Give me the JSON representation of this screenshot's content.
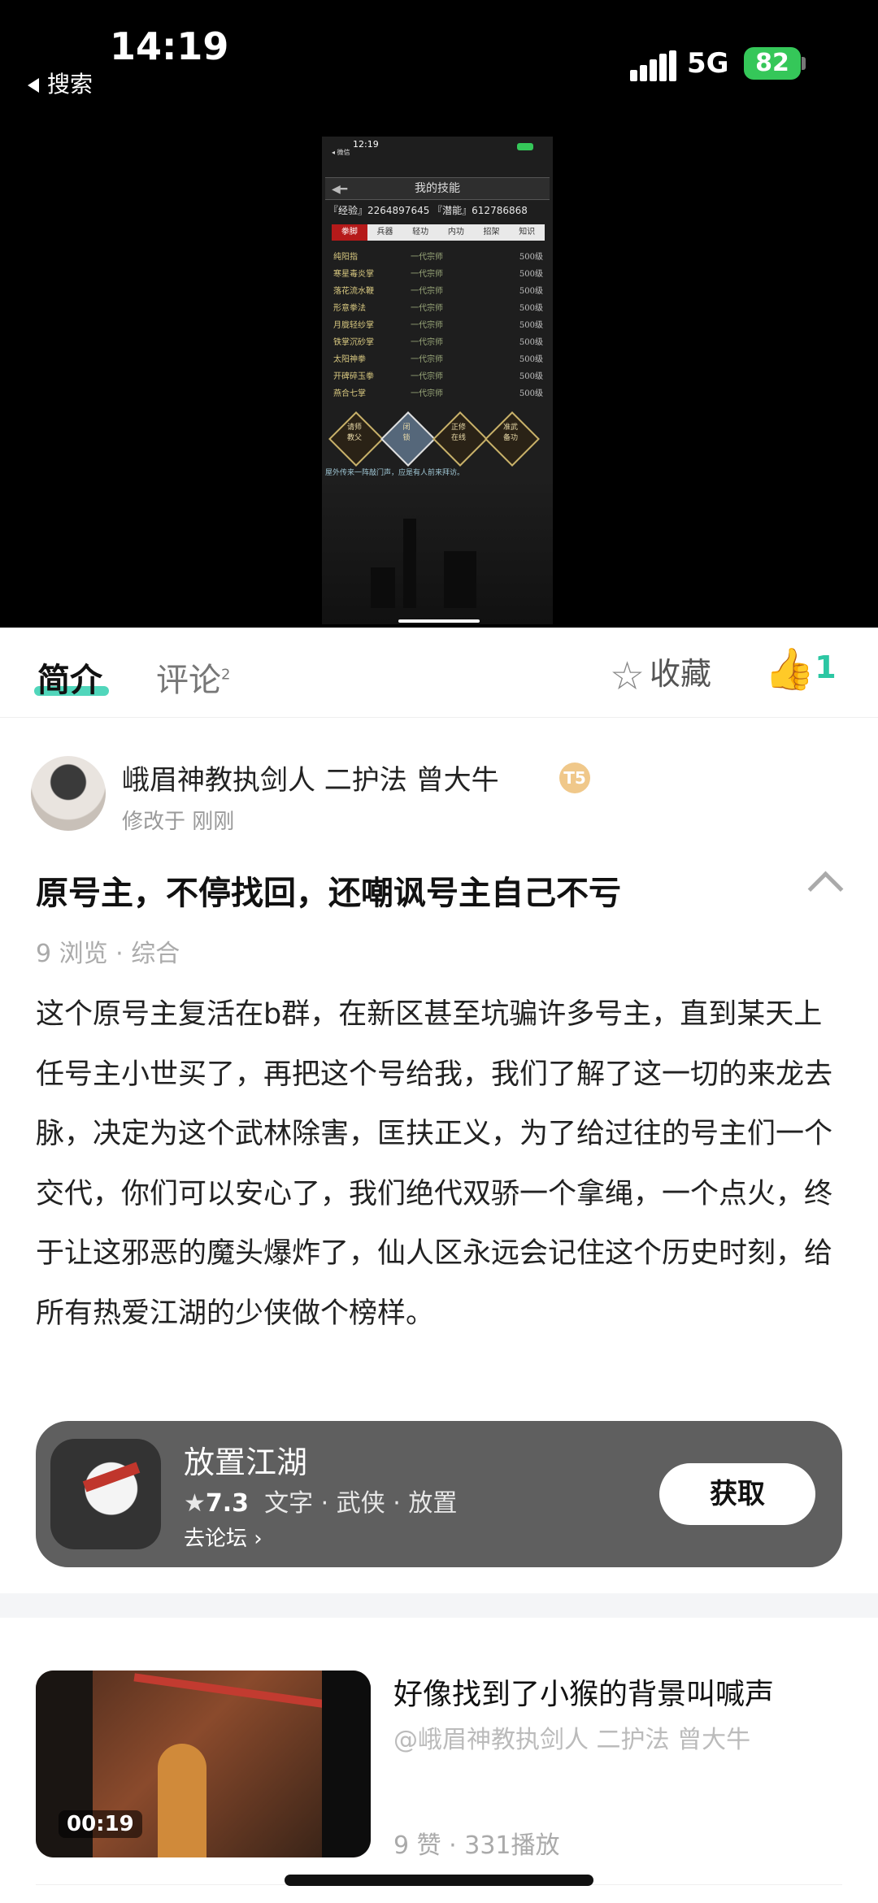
{
  "status_bar": {
    "time": "14:19",
    "back_label": "搜索",
    "network": "5G",
    "battery": "82"
  },
  "game_screenshot": {
    "time": "12:19",
    "back": "◂ 微信",
    "title": "我的技能",
    "exp_line": "『经验』2264897645 『潜能』612786868",
    "tabs": [
      "拳脚",
      "兵器",
      "轻功",
      "内功",
      "招架",
      "知识"
    ],
    "skills": [
      {
        "name": "纯阳指",
        "rank": "一代宗师",
        "level": "500级"
      },
      {
        "name": "寒星毒炎掌",
        "rank": "一代宗师",
        "level": "500级"
      },
      {
        "name": "落花流水鞭",
        "rank": "一代宗师",
        "level": "500级"
      },
      {
        "name": "形意拳法",
        "rank": "一代宗师",
        "level": "500级"
      },
      {
        "name": "月胧轻纱掌",
        "rank": "一代宗师",
        "level": "500级"
      },
      {
        "name": "铁掌沉砂掌",
        "rank": "一代宗师",
        "level": "500级"
      },
      {
        "name": "太阳神拳",
        "rank": "一代宗师",
        "level": "500级"
      },
      {
        "name": "开碑碎玉拳",
        "rank": "一代宗师",
        "level": "500级"
      },
      {
        "name": "燕合七掌",
        "rank": "一代宗师",
        "level": "500级"
      }
    ],
    "buttons": [
      {
        "line1": "请师",
        "line2": "教父"
      },
      {
        "line1": "闭",
        "line2": "锁"
      },
      {
        "line1": "正修",
        "line2": "在线"
      },
      {
        "line1": "准武",
        "line2": "备功"
      }
    ],
    "message": "屋外传来一阵敲门声，应是有人前来拜访。"
  },
  "tabs": {
    "intro": "简介",
    "comments": "评论",
    "comments_count": "2",
    "favorite": "收藏",
    "like_count": "1"
  },
  "post": {
    "author": "峨眉神教执剑人 二护法 曾大牛",
    "badge": "T5",
    "edited": "修改于 刚刚",
    "title": "原号主，不停找回，还嘲讽号主自己不亏",
    "meta": "9 浏览 · 综合",
    "body": "这个原号主复活在b群，在新区甚至坑骗许多号主，直到某天上任号主小世买了，再把这个号给我，我们了解了这一切的来龙去脉，决定为这个武林除害，匡扶正义，为了给过往的号主们一个交代，你们可以安心了，我们绝代双骄一个拿绳，一个点火，终于让这邪恶的魔头爆炸了，仙人区永远会记住这个历史时刻，给所有热爱江湖的少侠做个榜样。"
  },
  "app_card": {
    "name": "放置江湖",
    "rating": "7.3",
    "tags": "文字 · 武侠 · 放置",
    "forum_link": "去论坛",
    "get_button": "获取"
  },
  "related_video": {
    "duration": "00:19",
    "title": "好像找到了小猴的背景叫喊声",
    "author": "@峨眉神教执剑人 二护法 曾大牛",
    "stats": "9 赞 · 331播放"
  }
}
